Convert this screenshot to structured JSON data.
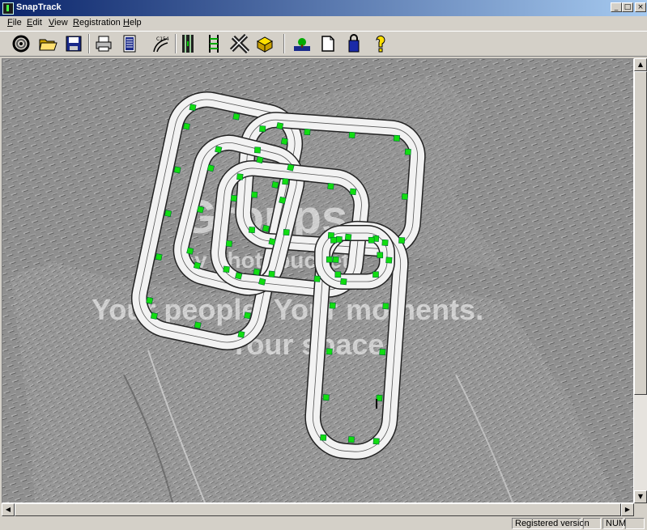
{
  "window": {
    "title": "SnapTrack",
    "minimize_glyph": "_",
    "maximize_glyph": "□",
    "close_glyph": "×"
  },
  "menu": [
    {
      "u": "F",
      "rest": "ile"
    },
    {
      "u": "E",
      "rest": "dit"
    },
    {
      "u": "V",
      "rest": "iew"
    },
    {
      "u": "R",
      "rest": "egistration"
    },
    {
      "u": "H",
      "rest": "elp"
    }
  ],
  "toolbar": {
    "buttons": [
      "new-track-icon",
      "open-folder-icon",
      "save-disk-icon",
      "print-icon",
      "parts-list-icon",
      "curve-c154-icon",
      "straight-track-icon",
      "track-gauge-icon",
      "crossing-icon",
      "lane-change-icon",
      "landscape-icon",
      "page-setup-icon",
      "registration-icon",
      "help-icon"
    ],
    "curve_label": "C154"
  },
  "watermark": {
    "brand": "Groups",
    "byline": "by photobucket",
    "tagline_1": "Your people. Your moments.",
    "tagline_2": "Your space."
  },
  "statusbar": {
    "message": "",
    "registration": "Registered version",
    "caps": "",
    "num": "NUM",
    "scrl": ""
  },
  "scroll_glyphs": {
    "up": "▲",
    "down": "▼",
    "left": "◀",
    "right": "▶"
  }
}
